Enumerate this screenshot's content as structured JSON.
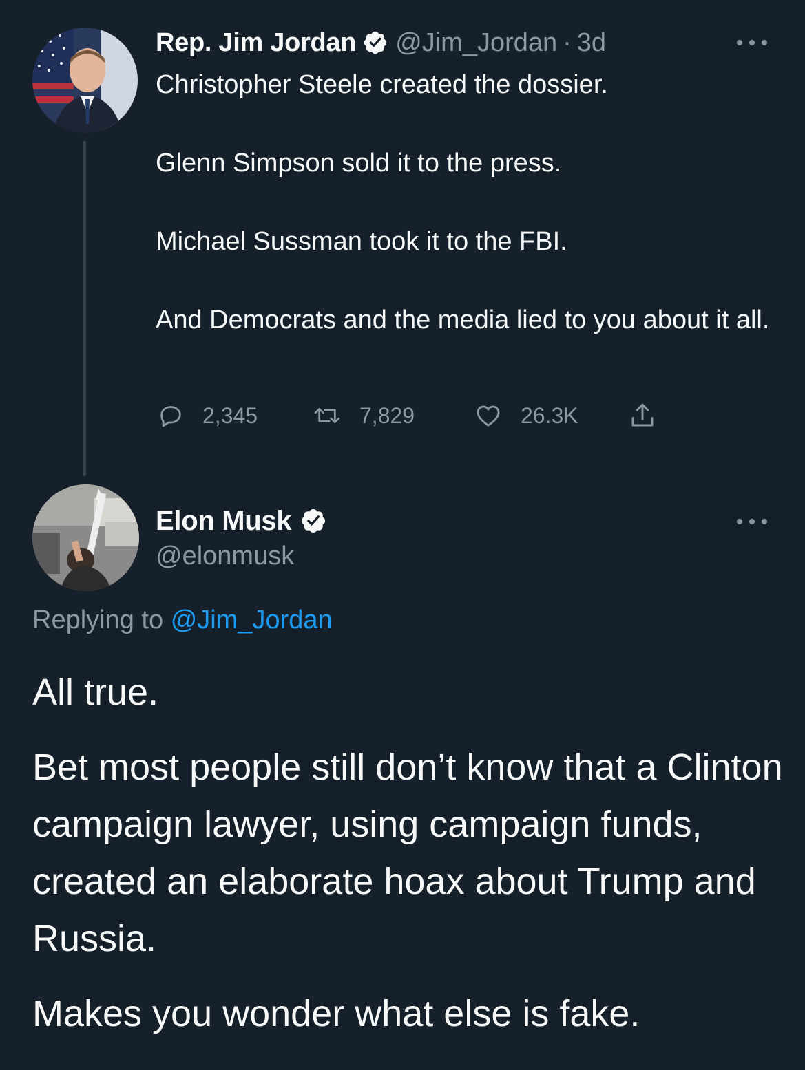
{
  "parent_tweet": {
    "display_name": "Rep. Jim Jordan",
    "handle": "@Jim_Jordan",
    "separator": "·",
    "time": "3d",
    "paragraphs": [
      "Christopher Steele created the dossier.",
      "Glenn Simpson sold it to the press.",
      "Michael Sussman took it to the FBI.",
      "And Democrats and the media lied to you about it all."
    ],
    "actions": {
      "replies": "2,345",
      "retweets": "7,829",
      "likes": "26.3K"
    },
    "icons": {
      "verified": "verified-badge-icon",
      "more": "more-options-icon",
      "reply": "reply-bubble-icon",
      "retweet": "retweet-icon",
      "like": "heart-icon",
      "share": "share-icon"
    }
  },
  "reply_tweet": {
    "display_name": "Elon Musk",
    "handle": "@elonmusk",
    "replying_prefix": "Replying to",
    "replying_to": "@Jim_Jordan",
    "paragraphs": [
      "All true.",
      "Bet most people still don’t know that a Clinton campaign lawyer, using campaign funds, created an elaborate hoax about Trump and Russia.",
      "Makes you wonder what else is fake."
    ]
  },
  "colors": {
    "background": "#15202b",
    "text_primary": "#f7f9f9",
    "text_secondary": "#8b98a5",
    "accent": "#1d9bf0",
    "thread_line": "#38444d"
  }
}
